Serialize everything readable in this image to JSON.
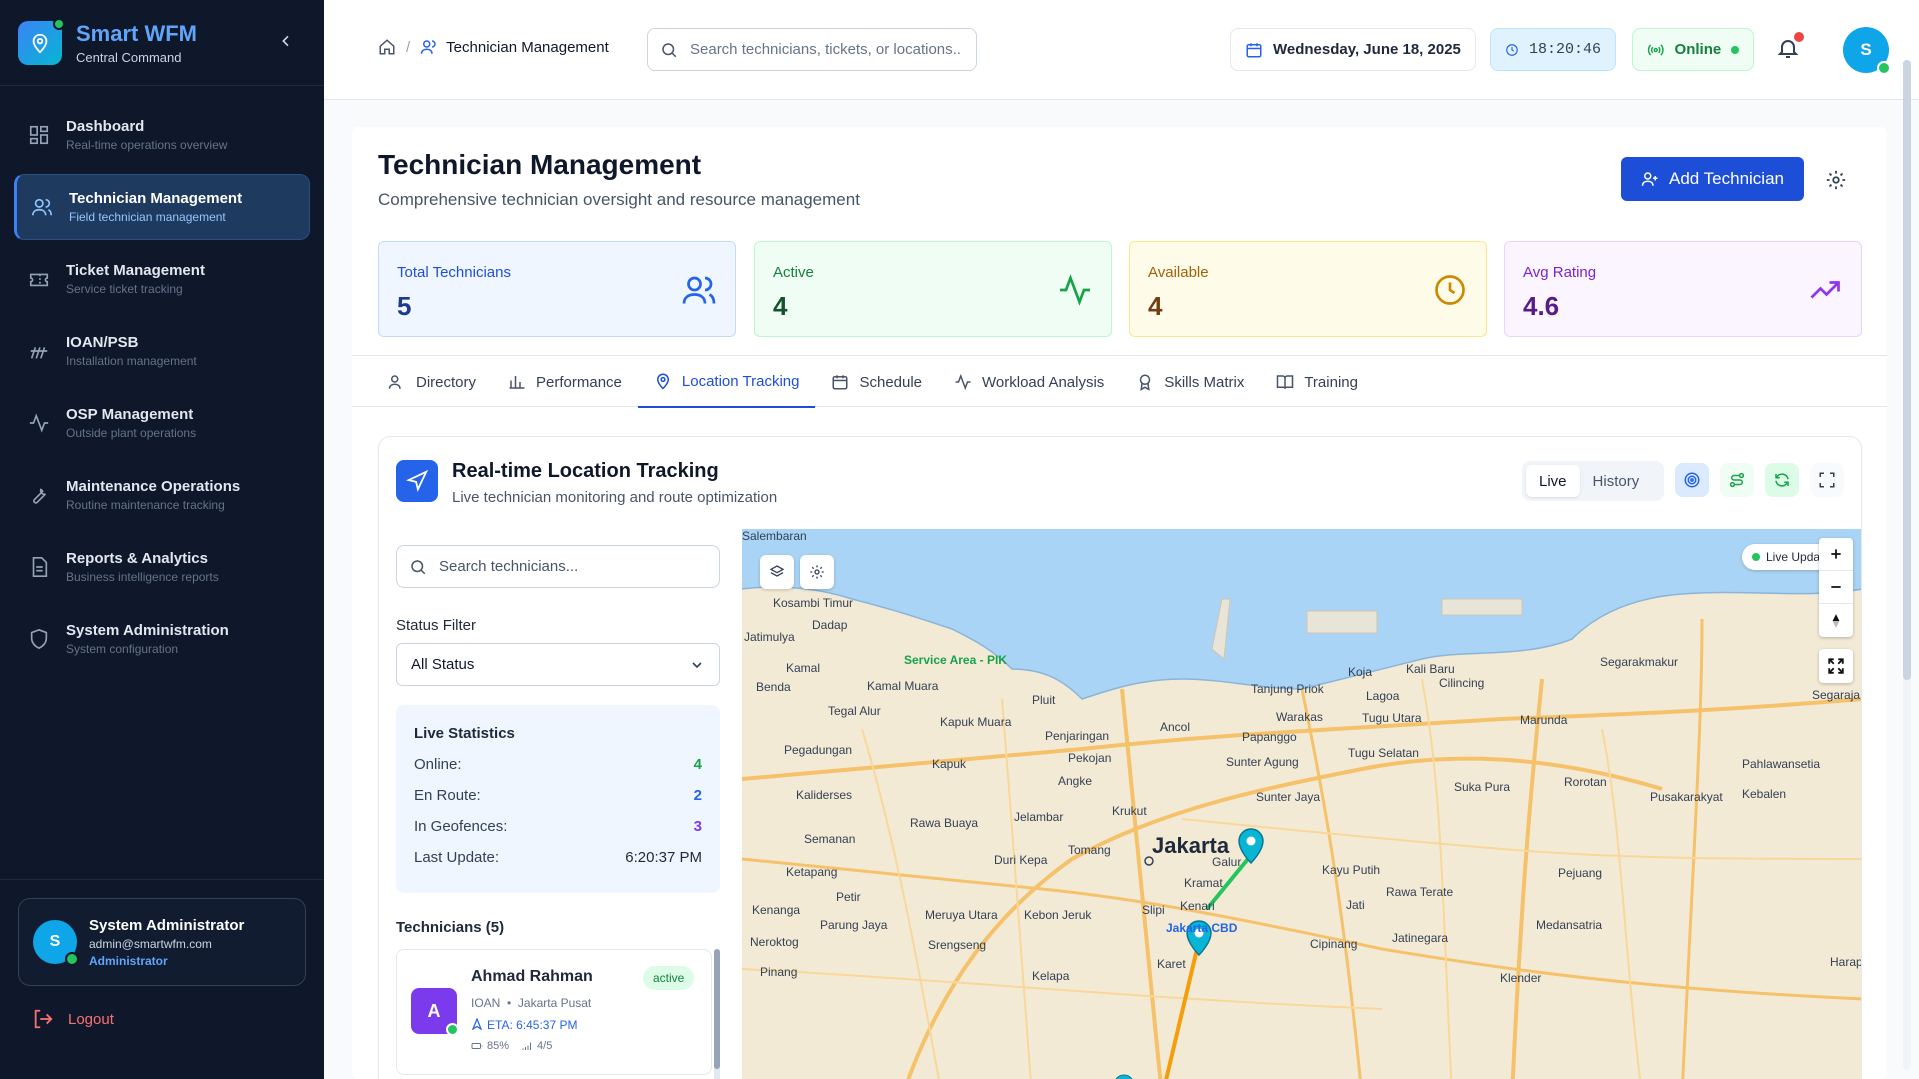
{
  "sidebar": {
    "brand_title": "Smart WFM",
    "brand_sub": "Central Command",
    "items": [
      {
        "label": "Dashboard",
        "desc": "Real-time operations overview",
        "icon": "grid-icon"
      },
      {
        "label": "Technician Management",
        "desc": "Field technician management",
        "icon": "users-icon",
        "active": true
      },
      {
        "label": "Ticket Management",
        "desc": "Service ticket tracking",
        "icon": "ticket-icon"
      },
      {
        "label": "IOAN/PSB",
        "desc": "Installation management",
        "icon": "signal-icon"
      },
      {
        "label": "OSP Management",
        "desc": "Outside plant operations",
        "icon": "activity-icon"
      },
      {
        "label": "Maintenance Operations",
        "desc": "Routine maintenance tracking",
        "icon": "wrench-icon"
      },
      {
        "label": "Reports & Analytics",
        "desc": "Business intelligence reports",
        "icon": "file-icon"
      },
      {
        "label": "System Administration",
        "desc": "System configuration",
        "icon": "shield-icon"
      }
    ],
    "user": {
      "initial": "S",
      "name": "System Administrator",
      "email": "admin@smartwfm.com",
      "role": "Administrator"
    },
    "logout": "Logout"
  },
  "topbar": {
    "breadcrumb": "Technician Management",
    "search_placeholder": "Search technicians, tickets, or locations...",
    "date": "Wednesday, June 18, 2025",
    "time": "18:20:46",
    "status": "Online",
    "avatar_initial": "S"
  },
  "page": {
    "title": "Technician Management",
    "subtitle": "Comprehensive technician oversight and resource management",
    "add_button": "Add Technician"
  },
  "stats": [
    {
      "label": "Total Technicians",
      "value": "5",
      "icon": "users-icon"
    },
    {
      "label": "Active",
      "value": "4",
      "icon": "activity-icon"
    },
    {
      "label": "Available",
      "value": "4",
      "icon": "clock-icon"
    },
    {
      "label": "Avg Rating",
      "value": "4.6",
      "icon": "trending-up-icon"
    }
  ],
  "tabs": [
    "Directory",
    "Performance",
    "Location Tracking",
    "Schedule",
    "Workload Analysis",
    "Skills Matrix",
    "Training"
  ],
  "active_tab": "Location Tracking",
  "tracking": {
    "title": "Real-time Location Tracking",
    "subtitle": "Live technician monitoring and route optimization",
    "mode_live": "Live",
    "mode_history": "History",
    "search_placeholder": "Search technicians...",
    "status_filter_label": "Status Filter",
    "status_filter_value": "All Status",
    "live_stats": {
      "title": "Live Statistics",
      "rows": [
        {
          "label": "Online:",
          "value": "4"
        },
        {
          "label": "En Route:",
          "value": "2"
        },
        {
          "label": "In Geofences:",
          "value": "3"
        },
        {
          "label": "Last Update:",
          "value": "6:20:37 PM"
        }
      ]
    },
    "technicians_title": "Technicians (5)",
    "technicians": [
      {
        "initial": "A",
        "name": "Ahmad Rahman",
        "status": "active",
        "type": "IOAN",
        "location": "Jakarta Pusat",
        "eta": "ETA: 6:45:37 PM",
        "battery": "85%",
        "signal": "4/5"
      }
    ]
  },
  "map": {
    "live_badge": "Live Updat",
    "city": "Jakarta",
    "service_area": "Service Area - PIK",
    "cbd": "Jakarta CBD",
    "colors": {
      "water": "#a9d4f5",
      "land": "#f3ead5",
      "road": "#f5c26b",
      "route": "#22c55e",
      "pin": "#06b6d4"
    },
    "labels": [
      "Salembaran",
      "Kosambi Timur",
      "Dadap",
      "Jatimulya",
      "Kamal",
      "Benda",
      "Kamal Muara",
      "Tegal Alur",
      "Pluit",
      "Kapuk Muara",
      "Penjaringan",
      "Pegadungan",
      "Kapuk",
      "Pekojan",
      "Ancol",
      "Papanggo",
      "Warakas",
      "Tanjung Priok",
      "Koja",
      "Kali Baru",
      "Cilincing",
      "Lagoa",
      "Tugu Utara",
      "Marunda",
      "Segarakmakur",
      "Segaraja",
      "Tugu Selatan",
      "Sunter Agung",
      "Sunter Jaya",
      "Kaliderses",
      "Angke",
      "Rawa Buaya",
      "Jelambar",
      "Krukut",
      "Semanan",
      "Tomang",
      "Duri Kepa",
      "Galur",
      "Kayu Putih",
      "Kramat",
      "Ketapang",
      "Petir",
      "Kenanga",
      "Parung Jaya",
      "Meruya Utara",
      "Kebon Jeruk",
      "Slipi",
      "Kenari",
      "Rawa Terate",
      "Jati",
      "Pejuang",
      "Medansatria",
      "Neroktog",
      "Srengseng",
      "Cipinang",
      "Jatinegara",
      "Karet",
      "Pinang",
      "Kelapa",
      "Klender",
      "Rorotan",
      "Pusakarakyat",
      "Kebalen",
      "Suka Pura",
      "Pahlawansetia",
      "Harapan"
    ]
  }
}
